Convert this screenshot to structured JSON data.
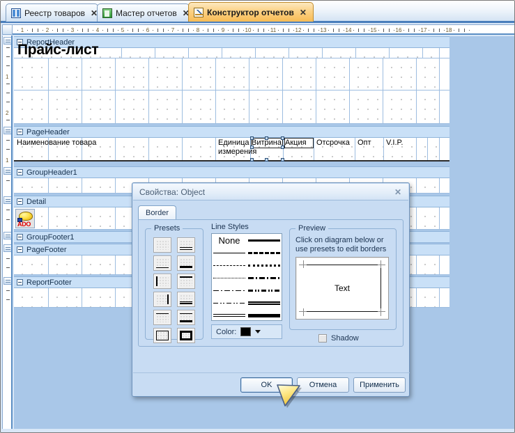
{
  "window": {
    "title": "Конструктор отчетов"
  },
  "tabs": [
    {
      "label": "Реестр товаров",
      "icon": "book-icon",
      "close": "✕",
      "active": false
    },
    {
      "label": "Мастер отчетов",
      "icon": "report-icon",
      "close": "✕",
      "active": false
    },
    {
      "label": "Конструктор отчетов",
      "icon": "designer-icon",
      "close": "✕",
      "active": true
    }
  ],
  "rulers": {
    "horizontal_ticks": [
      "1",
      "2",
      "3",
      "4",
      "5",
      "6",
      "7",
      "8",
      "9",
      "10",
      "11",
      "12",
      "13",
      "14",
      "15",
      "16",
      "17",
      "18"
    ],
    "vertical_ticks": [
      "1",
      "2",
      "1"
    ]
  },
  "designer": {
    "bands": [
      {
        "name": "ReportHeader",
        "label": "ReportHeader"
      },
      {
        "name": "PageHeader",
        "label": "PageHeader"
      },
      {
        "name": "GroupHeader1",
        "label": "GroupHeader1"
      },
      {
        "name": "Detail",
        "label": "Detail"
      },
      {
        "name": "GroupFooter1",
        "label": "GroupFooter1"
      },
      {
        "name": "PageFooter",
        "label": "PageFooter"
      },
      {
        "name": "ReportFooter",
        "label": "ReportFooter"
      }
    ],
    "report_title": "Прайс-лист",
    "page_header_columns": [
      "Наименование товара",
      "Единица измерения",
      "Витрина",
      "Акция",
      "Отсрочка",
      "Опт",
      "V.I.P."
    ],
    "detail_icon_label": "ADO"
  },
  "dialog": {
    "title": "Свойства: Object",
    "close": "✕",
    "tabs": [
      {
        "label": "Border",
        "active": true
      }
    ],
    "presets": {
      "label": "Presets"
    },
    "line_styles": {
      "label": "Line Styles",
      "none_label": "None",
      "color_label": "Color:",
      "color_value": "#000000"
    },
    "preview": {
      "label": "Preview",
      "hint_line1": "Click on diagram below or",
      "hint_line2": "use presets to edit borders",
      "diagram_text": "Text",
      "shadow_label": "Shadow",
      "shadow_checked": false
    },
    "buttons": {
      "ok": "OK",
      "cancel": "Отмена",
      "apply": "Применить"
    }
  },
  "colors": {
    "active_tab": "#f8bc55",
    "band_header": "#c9e0f7",
    "canvas": "#a9c7e8",
    "dialog": "#c8dcf3",
    "accent": "#4a7ebb"
  }
}
